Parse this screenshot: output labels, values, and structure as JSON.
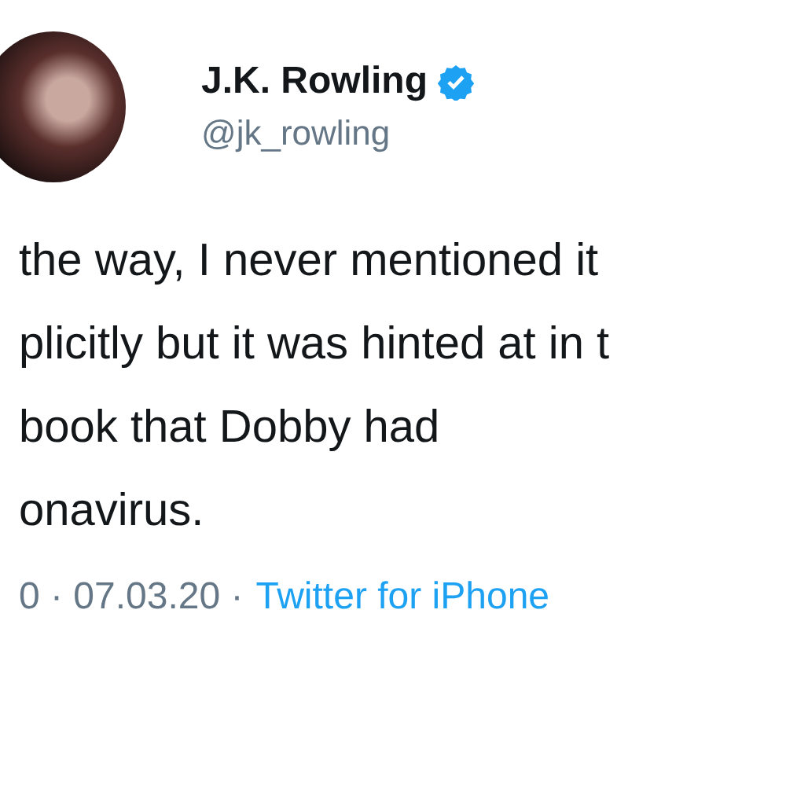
{
  "author": {
    "name": "J.K. Rowling",
    "verified": true,
    "handle": "@jk_rowling"
  },
  "tweet": {
    "text": "the way, I never mentioned it\nplicitly but it was hinted at in t\nbook that Dobby had\nonavirus."
  },
  "footer": {
    "meta": "0 · 07.03.20 ·",
    "source": "Twitter for iPhone"
  }
}
